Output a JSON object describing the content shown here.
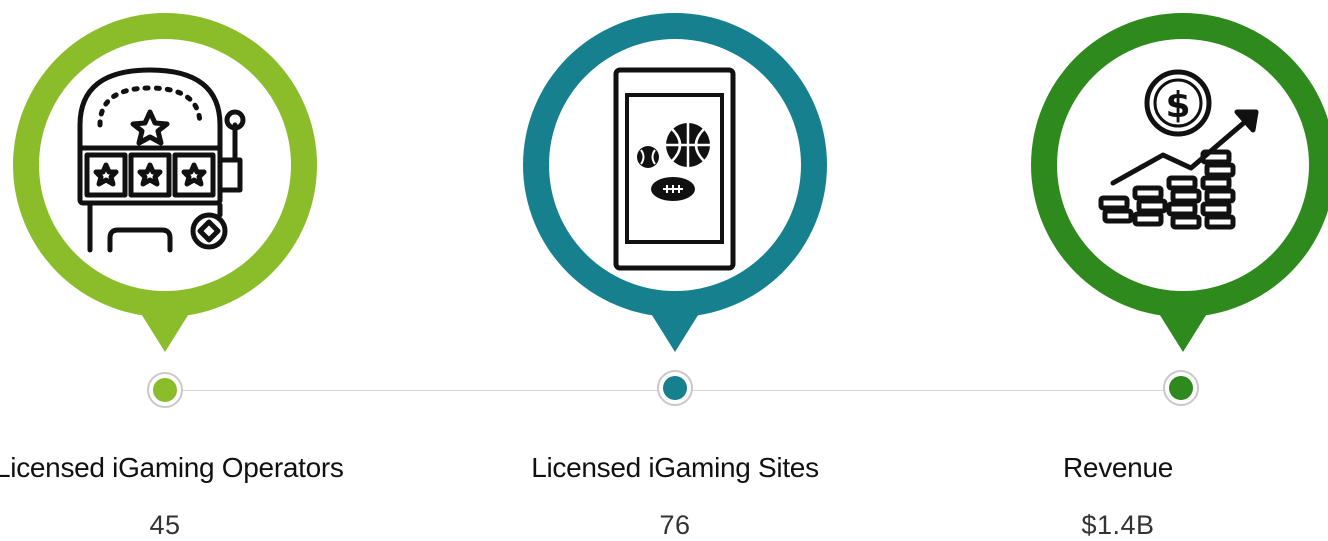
{
  "stats": [
    {
      "label": "Licensed iGaming Operators",
      "value": "45",
      "color": "#8bbd2a",
      "icon": "slot-machine-icon"
    },
    {
      "label": "Licensed iGaming Sites",
      "value": "76",
      "color": "#16808f",
      "icon": "mobile-sports-betting-icon"
    },
    {
      "label": "Revenue",
      "value": "$1.4B",
      "color": "#2e8a1c",
      "icon": "revenue-growth-icon"
    }
  ]
}
